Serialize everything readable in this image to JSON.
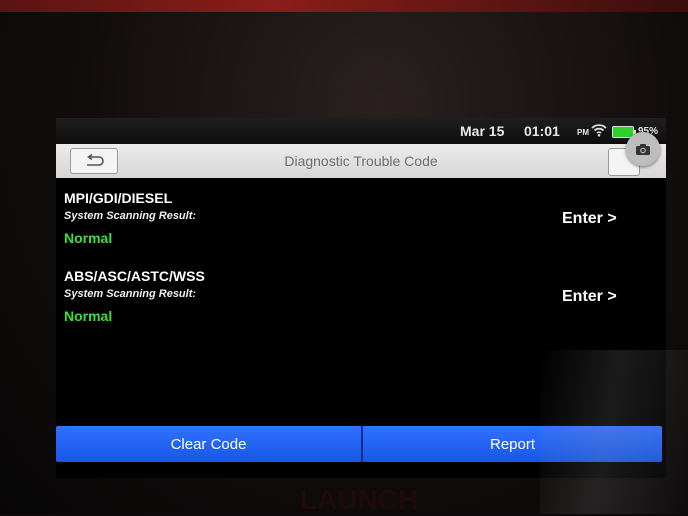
{
  "status_bar": {
    "date": "Mar 15",
    "time": "01:01",
    "ampm": "PM",
    "battery_text": "95%",
    "wifi_icon": "wifi-icon",
    "battery_icon": "battery-icon",
    "battery_level": 0.95,
    "battery_color": "#2fd12f"
  },
  "header": {
    "title": "Diagnostic Trouble Code",
    "back_icon": "back-icon",
    "camera_icon": "camera-icon"
  },
  "systems": [
    {
      "name": "MPI/GDI/DIESEL",
      "label": "System Scanning Result:",
      "status": "Normal",
      "enter_label": "Enter >"
    },
    {
      "name": "ABS/ASC/ASTC/WSS",
      "label": "System Scanning Result:",
      "status": "Normal",
      "enter_label": "Enter >"
    }
  ],
  "footer": {
    "clear_label": "Clear Code",
    "report_label": "Report"
  },
  "device": {
    "brand_text": "LAUNCH"
  },
  "colors": {
    "accent": "#2f72ff",
    "status_ok": "#3ce03c"
  }
}
